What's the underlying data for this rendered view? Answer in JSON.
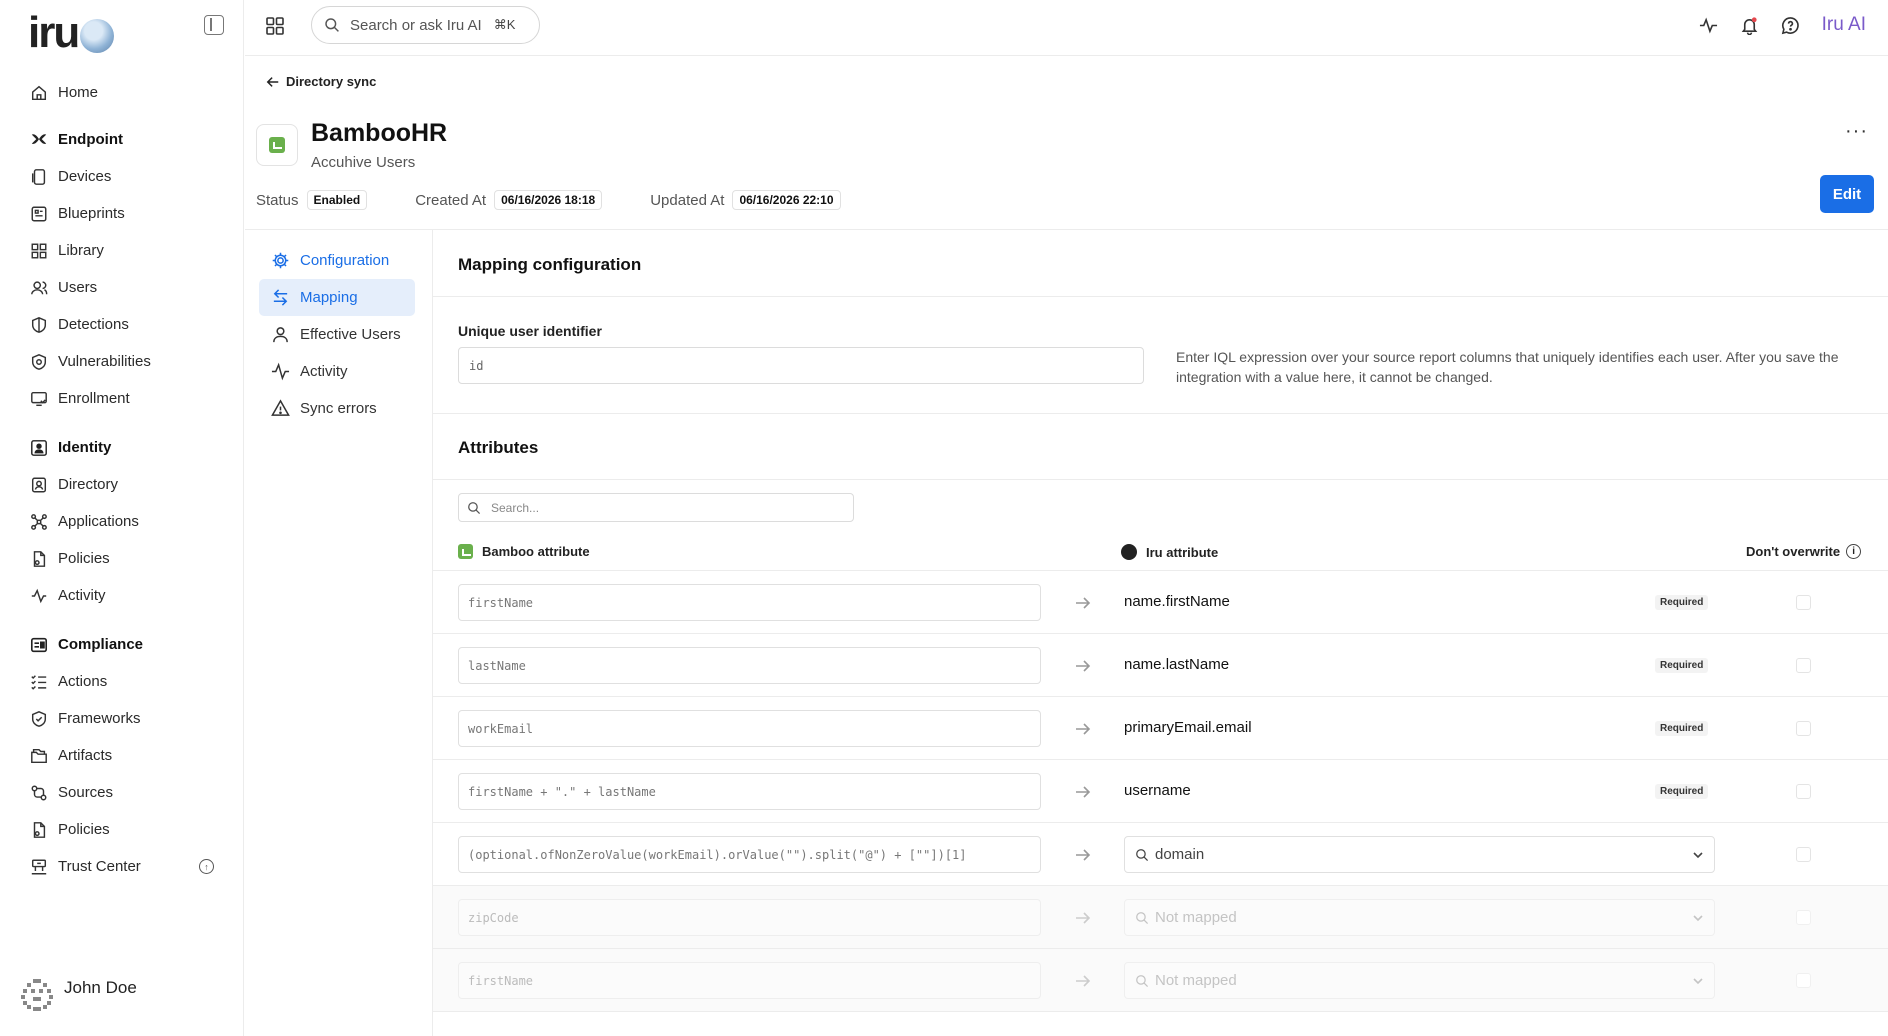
{
  "app": {
    "logo_text": "iru"
  },
  "sidebar": {
    "items": [
      {
        "label": "Home",
        "icon": "home-icon",
        "section": false
      },
      {
        "label": "Endpoint",
        "icon": "endpoint-icon",
        "section": true
      },
      {
        "label": "Devices",
        "icon": "device-icon",
        "section": false
      },
      {
        "label": "Blueprints",
        "icon": "blueprint-icon",
        "section": false
      },
      {
        "label": "Library",
        "icon": "library-icon",
        "section": false
      },
      {
        "label": "Users",
        "icon": "users-icon",
        "section": false
      },
      {
        "label": "Detections",
        "icon": "shield-icon",
        "section": false
      },
      {
        "label": "Vulnerabilities",
        "icon": "bug-shield-icon",
        "section": false
      },
      {
        "label": "Enrollment",
        "icon": "enrollment-icon",
        "section": false
      },
      {
        "label": "Identity",
        "icon": "identity-icon",
        "section": true
      },
      {
        "label": "Directory",
        "icon": "directory-icon",
        "section": false
      },
      {
        "label": "Applications",
        "icon": "applications-icon",
        "section": false
      },
      {
        "label": "Policies",
        "icon": "policy-icon",
        "section": false
      },
      {
        "label": "Activity",
        "icon": "activity-icon",
        "section": false
      },
      {
        "label": "Compliance",
        "icon": "compliance-icon",
        "section": true
      },
      {
        "label": "Actions",
        "icon": "actions-icon",
        "section": false
      },
      {
        "label": "Frameworks",
        "icon": "framework-icon",
        "section": false
      },
      {
        "label": "Artifacts",
        "icon": "artifacts-icon",
        "section": false
      },
      {
        "label": "Sources",
        "icon": "sources-icon",
        "section": false
      },
      {
        "label": "Policies",
        "icon": "policy-icon",
        "section": false
      },
      {
        "label": "Trust Center",
        "icon": "trust-center-icon",
        "section": false
      }
    ],
    "user_name": "John Doe"
  },
  "topbar": {
    "search_placeholder": "Search or ask Iru AI",
    "search_shortcut": "⌘K",
    "ai_label": "Iru AI"
  },
  "header": {
    "back_label": "Directory sync",
    "title": "BambooHR",
    "subtitle": "Accuhive Users",
    "status_label": "Status",
    "status_value": "Enabled",
    "created_label": "Created At",
    "created_value": "06/16/2026 18:18",
    "updated_label": "Updated At",
    "updated_value": "06/16/2026 22:10",
    "edit_label": "Edit",
    "more_label": "···"
  },
  "subnav": [
    {
      "label": "Configuration",
      "icon": "gear-icon"
    },
    {
      "label": "Mapping",
      "icon": "swap-icon"
    },
    {
      "label": "Effective Users",
      "icon": "user-icon"
    },
    {
      "label": "Activity",
      "icon": "activity-icon"
    },
    {
      "label": "Sync errors",
      "icon": "warning-icon"
    }
  ],
  "mapping": {
    "title": "Mapping configuration",
    "uid_label": "Unique user identifier",
    "uid_value": "id",
    "uid_help": "Enter IQL expression over your source report columns that uniquely identifies each user. After you save the integration with a value here, it cannot be changed.",
    "attributes_title": "Attributes",
    "search_placeholder": "Search...",
    "col_source": "Bamboo attribute",
    "col_target": "Iru attribute",
    "col_overwrite": "Don't overwrite",
    "required_label": "Required",
    "rows": [
      {
        "source": "firstName",
        "target": "name.firstName",
        "kind": "required"
      },
      {
        "source": "lastName",
        "target": "name.lastName",
        "kind": "required"
      },
      {
        "source": "workEmail",
        "target": "primaryEmail.email",
        "kind": "required"
      },
      {
        "source": "firstName + \".\" + lastName",
        "target": "username",
        "kind": "required"
      },
      {
        "source": "(optional.ofNonZeroValue(workEmail).orValue(\"\").split(\"@\") + [\"\"])[1]",
        "target": "domain",
        "kind": "select"
      },
      {
        "source": "zipCode",
        "target": "Not mapped",
        "kind": "select-dim"
      },
      {
        "source": "firstName",
        "target": "Not mapped",
        "kind": "select-dim"
      }
    ]
  },
  "colors": {
    "accent": "#1a6ee6",
    "ai": "#7a5ac9",
    "bamboo": "#6ab04c"
  }
}
